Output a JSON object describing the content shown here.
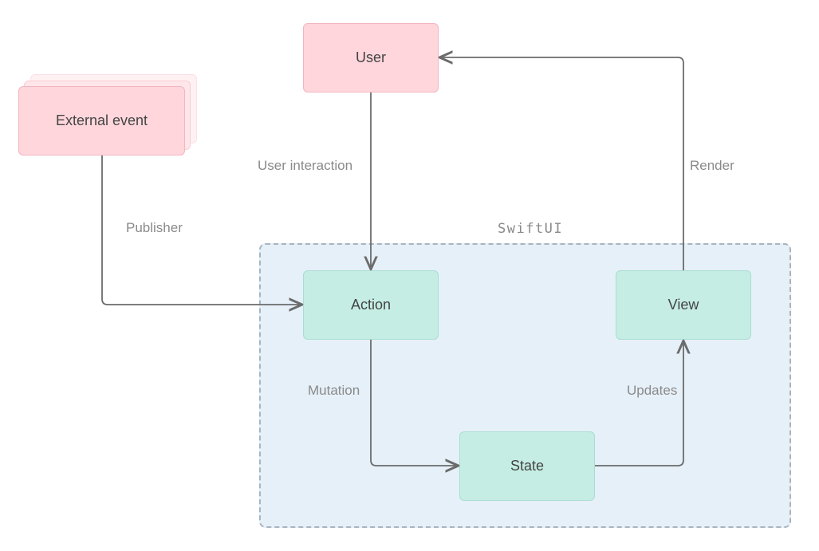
{
  "diagram": {
    "title": "SwiftUI",
    "nodes": {
      "user": "User",
      "external_event": "External event",
      "action": "Action",
      "state": "State",
      "view": "View"
    },
    "edges": {
      "user_interaction": "User interaction",
      "publisher": "Publisher",
      "mutation": "Mutation",
      "updates": "Updates",
      "render": "Render"
    }
  }
}
